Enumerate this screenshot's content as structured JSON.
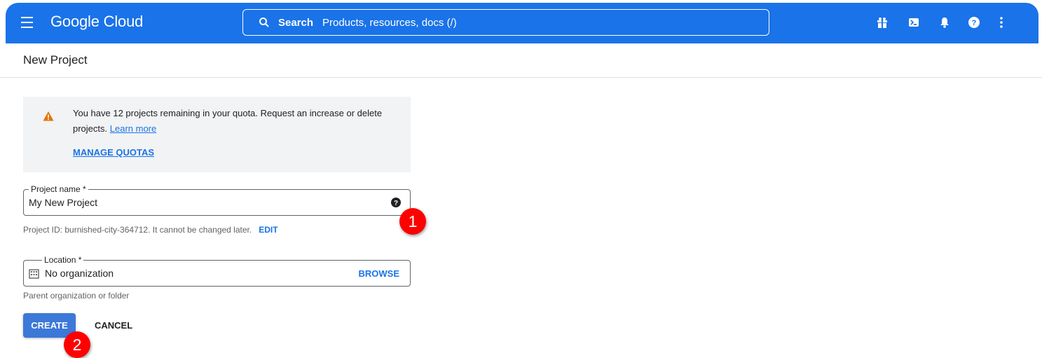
{
  "header": {
    "logo": "Google Cloud",
    "search_label": "Search",
    "search_placeholder": "Products, resources, docs (/)",
    "icons": [
      "gift-icon",
      "cloud-shell-icon",
      "notifications-icon",
      "help-icon",
      "more-vert-icon"
    ]
  },
  "page": {
    "title": "New Project"
  },
  "quota": {
    "message": "You have 12 projects remaining in your quota. Request an increase or delete projects.",
    "learn_more": "Learn more",
    "manage_label": "MANAGE QUOTAS"
  },
  "project_name": {
    "label": "Project name *",
    "value": "My New Project",
    "hint": "Project ID: burnished-city-364712. It cannot be changed later.",
    "edit_label": "EDIT"
  },
  "location": {
    "label": "Location *",
    "value": "No organization",
    "browse_label": "BROWSE",
    "hint": "Parent organization or folder"
  },
  "actions": {
    "create_label": "CREATE",
    "cancel_label": "CANCEL"
  },
  "annotations": {
    "one": "1",
    "two": "2"
  },
  "colors": {
    "brand_blue": "#1a73e8",
    "warning": "#e37400",
    "annotation_red": "#ff0000",
    "create_button": "#3c78d8"
  }
}
